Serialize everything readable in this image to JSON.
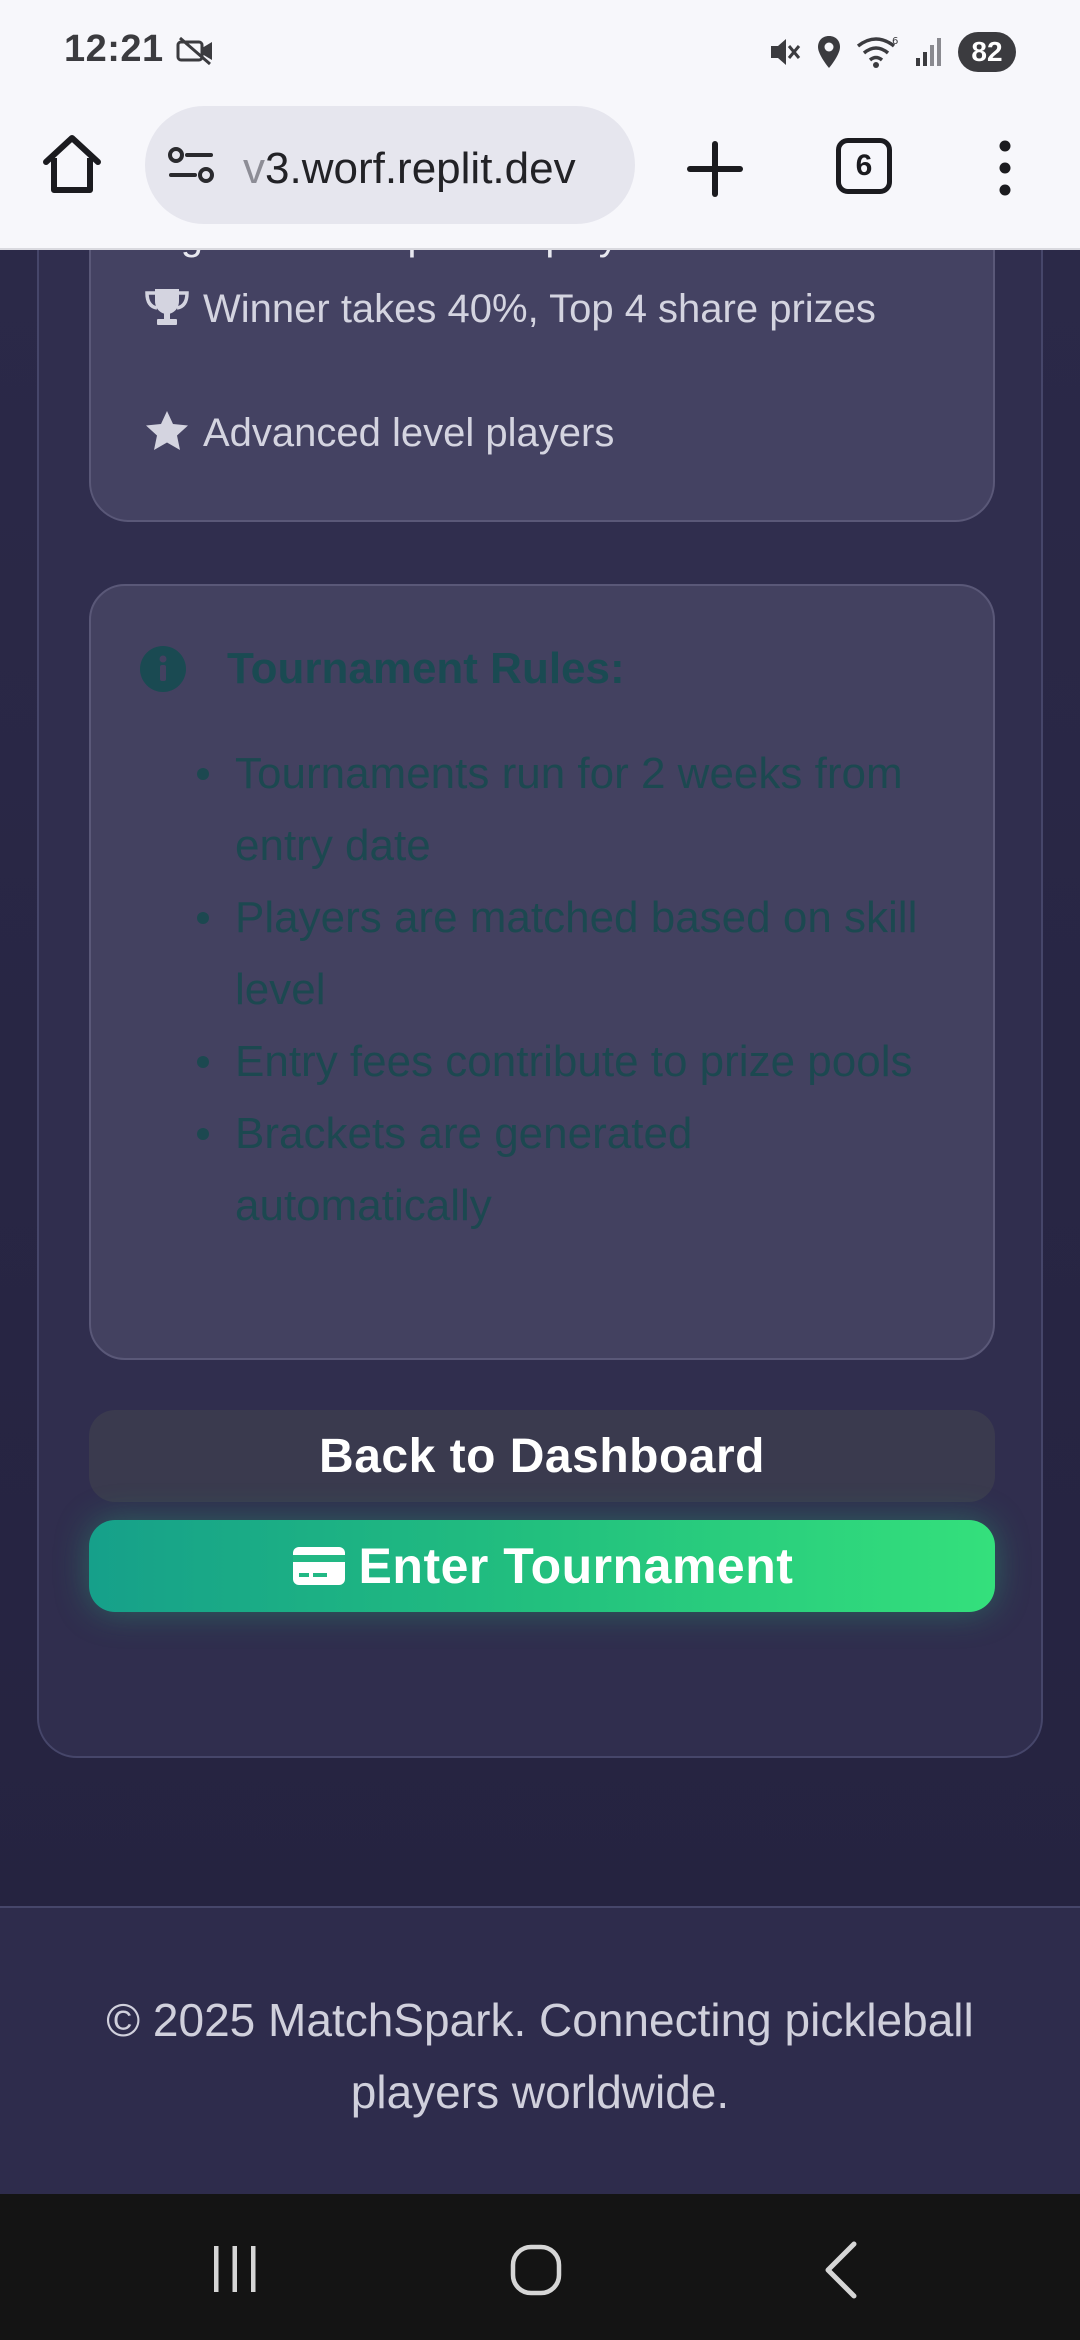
{
  "status_bar": {
    "time": "12:21",
    "battery": "82"
  },
  "browser": {
    "url_faded": "v",
    "url_main": "3.worf.replit.dev",
    "tab_count": "6"
  },
  "info_card": {
    "tagline": "High-level competitive play",
    "prize_text": "Winner takes 40%, Top 4 share prizes",
    "level_text": "Advanced level players"
  },
  "rules": {
    "heading": "Tournament Rules:",
    "items": [
      "Tournaments run for 2 weeks from entry date",
      "Players are matched based on skill level",
      "Entry fees contribute to prize pools",
      "Brackets are generated automatically"
    ]
  },
  "actions": {
    "back_label": "Back to Dashboard",
    "enter_label": "Enter Tournament"
  },
  "footer": {
    "text": "© 2025 MatchSpark. Connecting pickleball players worldwide."
  },
  "colors": {
    "page_bg": "#2b2948",
    "card_bg": "#444262",
    "accent_green": "#22c07e",
    "rules_text": "#1c4850"
  },
  "icons": {
    "prize": "trophy-icon",
    "level": "star-icon",
    "rules": "info-circle-icon",
    "enter": "credit-card-icon"
  }
}
